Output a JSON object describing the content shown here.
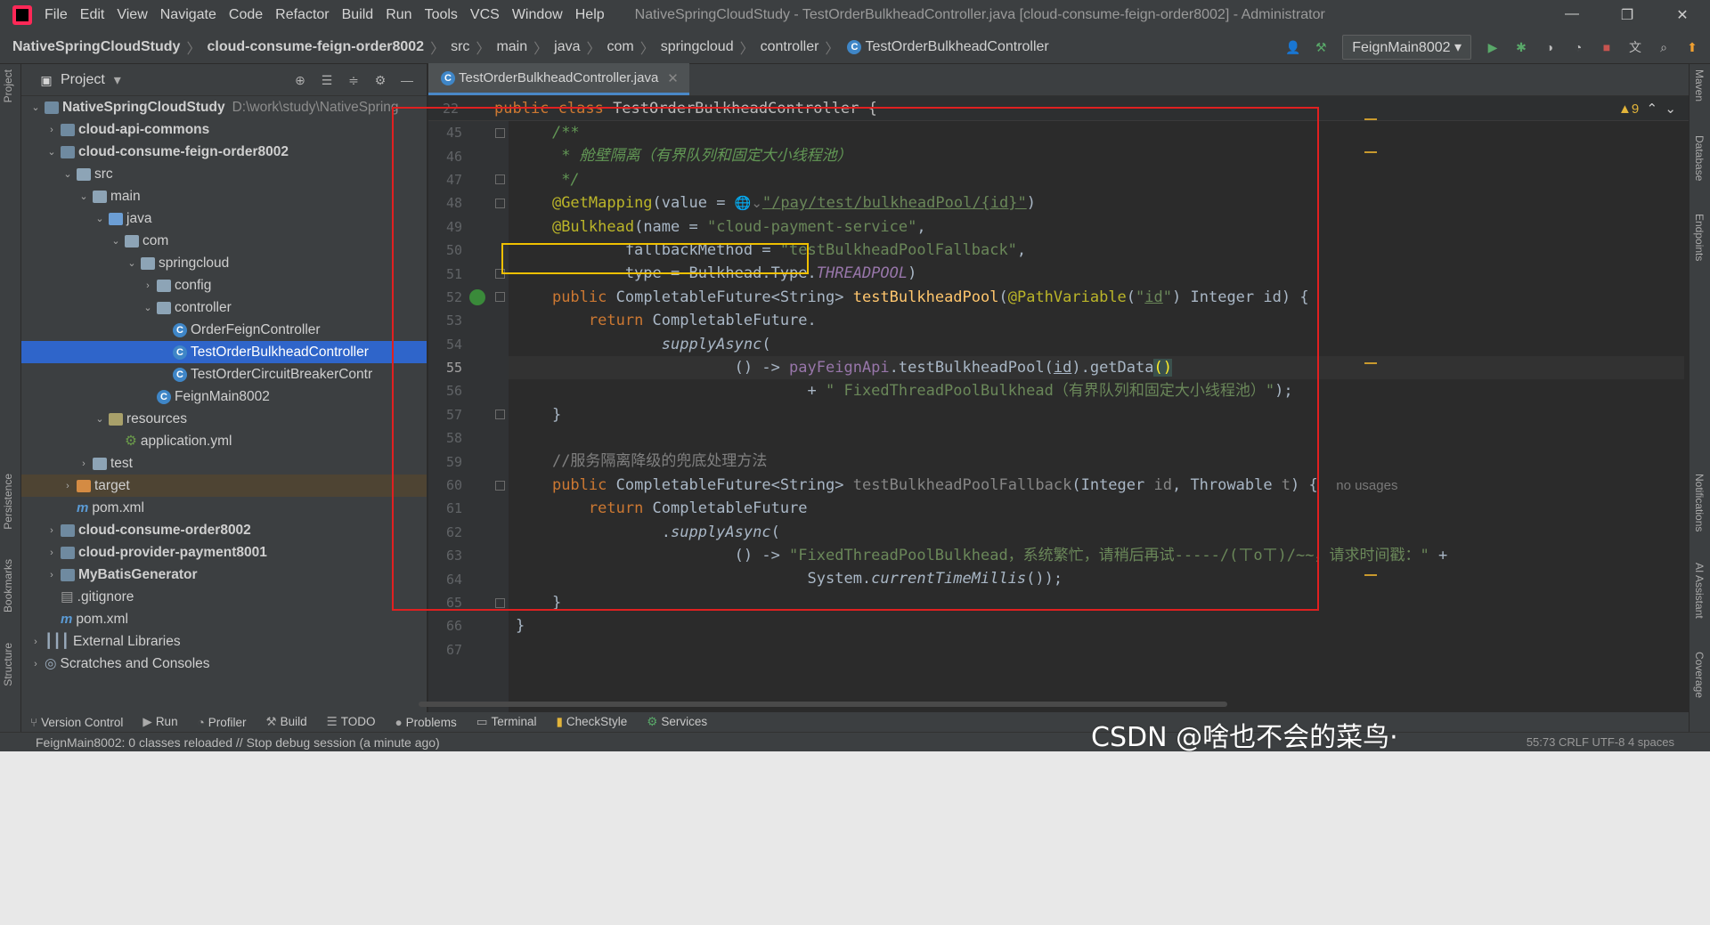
{
  "titlebar": {
    "menu": [
      "File",
      "Edit",
      "View",
      "Navigate",
      "Code",
      "Refactor",
      "Build",
      "Run",
      "Tools",
      "VCS",
      "Window",
      "Help"
    ],
    "title": "NativeSpringCloudStudy - TestOrderBulkheadController.java [cloud-consume-feign-order8002] - Administrator"
  },
  "breadcrumb": {
    "items": [
      "NativeSpringCloudStudy",
      "cloud-consume-feign-order8002",
      "src",
      "main",
      "java",
      "com",
      "springcloud",
      "controller",
      "TestOrderBulkheadController"
    ],
    "run_config": "FeignMain8002"
  },
  "project_panel": {
    "title": "Project",
    "tree": [
      {
        "label": "NativeSpringCloudStudy",
        "path": "D:\\work\\study\\NativeSpring",
        "indent": 0,
        "arrow": "v",
        "icon": "module",
        "bold": true
      },
      {
        "label": "cloud-api-commons",
        "indent": 1,
        "arrow": ">",
        "icon": "module",
        "bold": true
      },
      {
        "label": "cloud-consume-feign-order8002",
        "indent": 1,
        "arrow": "v",
        "icon": "module",
        "bold": true
      },
      {
        "label": "src",
        "indent": 2,
        "arrow": "v",
        "icon": "folder"
      },
      {
        "label": "main",
        "indent": 3,
        "arrow": "v",
        "icon": "folder"
      },
      {
        "label": "java",
        "indent": 4,
        "arrow": "v",
        "icon": "src"
      },
      {
        "label": "com",
        "indent": 5,
        "arrow": "v",
        "icon": "folder"
      },
      {
        "label": "springcloud",
        "indent": 6,
        "arrow": "v",
        "icon": "folder"
      },
      {
        "label": "config",
        "indent": 7,
        "arrow": ">",
        "icon": "folder"
      },
      {
        "label": "controller",
        "indent": 7,
        "arrow": "v",
        "icon": "folder"
      },
      {
        "label": "OrderFeignController",
        "indent": 8,
        "arrow": "",
        "icon": "class"
      },
      {
        "label": "TestOrderBulkheadController",
        "indent": 8,
        "arrow": "",
        "icon": "class",
        "selected": true
      },
      {
        "label": "TestOrderCircuitBreakerContr",
        "indent": 8,
        "arrow": "",
        "icon": "class"
      },
      {
        "label": "FeignMain8002",
        "indent": 7,
        "arrow": "",
        "icon": "class"
      },
      {
        "label": "resources",
        "indent": 4,
        "arrow": "v",
        "icon": "res"
      },
      {
        "label": "application.yml",
        "indent": 5,
        "arrow": "",
        "icon": "yml"
      },
      {
        "label": "test",
        "indent": 3,
        "arrow": ">",
        "icon": "folder"
      },
      {
        "label": "target",
        "indent": 2,
        "arrow": ">",
        "icon": "target",
        "target": true
      },
      {
        "label": "pom.xml",
        "indent": 2,
        "arrow": "",
        "icon": "maven"
      },
      {
        "label": "cloud-consume-order8002",
        "indent": 1,
        "arrow": ">",
        "icon": "module",
        "bold": true
      },
      {
        "label": "cloud-provider-payment8001",
        "indent": 1,
        "arrow": ">",
        "icon": "module",
        "bold": true
      },
      {
        "label": "MyBatisGenerator",
        "indent": 1,
        "arrow": ">",
        "icon": "module",
        "bold": true
      },
      {
        "label": ".gitignore",
        "indent": 1,
        "arrow": "",
        "icon": "file"
      },
      {
        "label": "pom.xml",
        "indent": 1,
        "arrow": "",
        "icon": "maven"
      },
      {
        "label": "External Libraries",
        "indent": 0,
        "arrow": ">",
        "icon": "lib"
      },
      {
        "label": "Scratches and Consoles",
        "indent": 0,
        "arrow": ">",
        "icon": "scratch"
      }
    ]
  },
  "editor": {
    "tab": "TestOrderBulkheadController.java",
    "sticky_line_number": "22",
    "sticky_text": "public class TestOrderBulkheadController {",
    "warnings": "▲9",
    "line_numbers": [
      "45",
      "46",
      "47",
      "48",
      "49",
      "50",
      "51",
      "52",
      "53",
      "54",
      "55",
      "56",
      "57",
      "58",
      "59",
      "60",
      "61",
      "62",
      "63",
      "64",
      "65",
      "66",
      "67"
    ],
    "current_line": "55"
  },
  "left_strip": [
    "Project",
    "Persistence",
    "Bookmarks",
    "Structure"
  ],
  "right_strip": [
    "Maven",
    "Database",
    "Endpoints",
    "Notifications",
    "AI Assistant",
    "Coverage"
  ],
  "bottom_tabs": [
    "Version Control",
    "Run",
    "Profiler",
    "Build",
    "TODO",
    "Problems",
    "Terminal",
    "CheckStyle",
    "Services"
  ],
  "status": {
    "message": "FeignMain8002: 0 classes reloaded // Stop debug session (a minute ago)",
    "right": "55:73   CRLF   UTF-8   4 spaces"
  },
  "watermark": "CSDN @啥也不会的菜鸟·"
}
